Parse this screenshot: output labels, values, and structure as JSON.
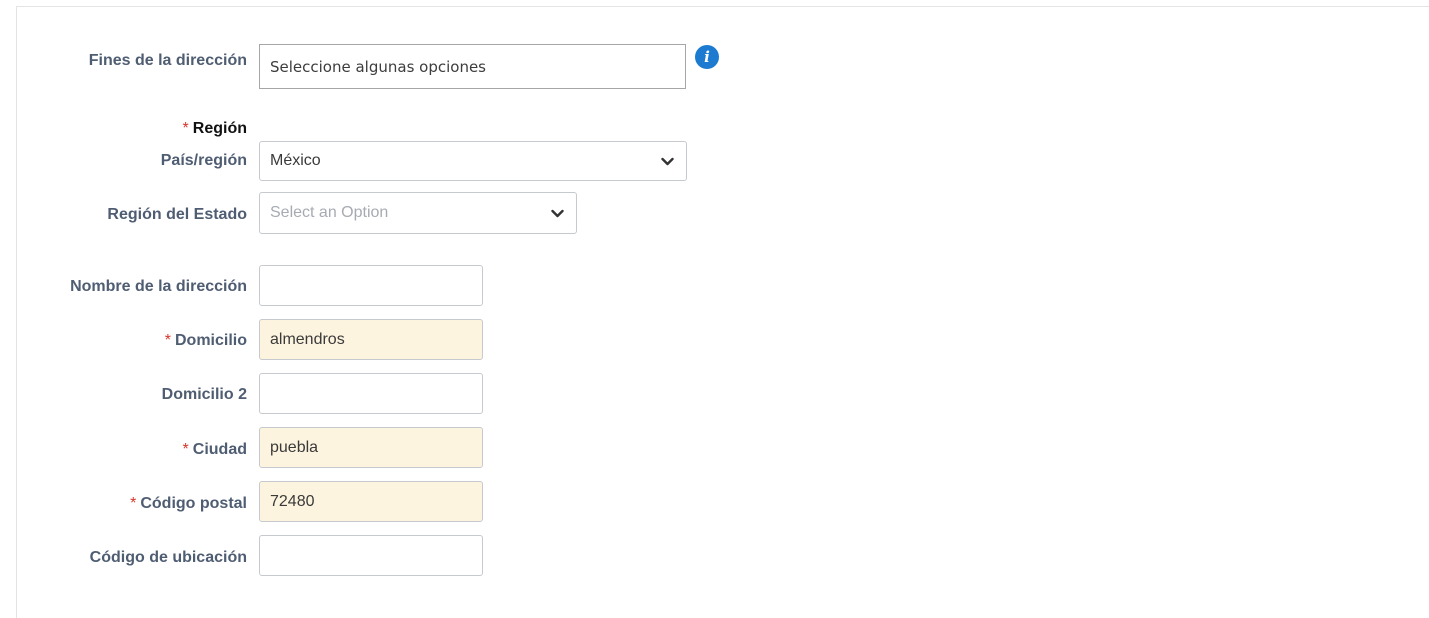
{
  "form": {
    "purposes": {
      "label": "Fines de la dirección",
      "placeholder": "Seleccione algunas opciones"
    },
    "region_heading": {
      "required_mark": "*",
      "label": "Región"
    },
    "country": {
      "label": "País/región",
      "value": "México"
    },
    "state": {
      "label": "Región del Estado",
      "placeholder": "Select an Option"
    },
    "address_name": {
      "label": "Nombre de la dirección",
      "value": ""
    },
    "street": {
      "required_mark": "*",
      "label": "Domicilio",
      "value": "almendros"
    },
    "street2": {
      "label": "Domicilio 2",
      "value": ""
    },
    "city": {
      "required_mark": "*",
      "label": "Ciudad",
      "value": "puebla"
    },
    "postal_code": {
      "required_mark": "*",
      "label": "Código postal",
      "value": "72480"
    },
    "location_code": {
      "label": "Código de ubicación",
      "value": ""
    }
  },
  "icons": {
    "info": "info-icon",
    "dropdown": "chevron-down-icon"
  },
  "colors": {
    "label": "#4f5d72",
    "required": "#d8352a",
    "filled_bg": "#fdf4e0",
    "info": "#1c7bd1"
  }
}
